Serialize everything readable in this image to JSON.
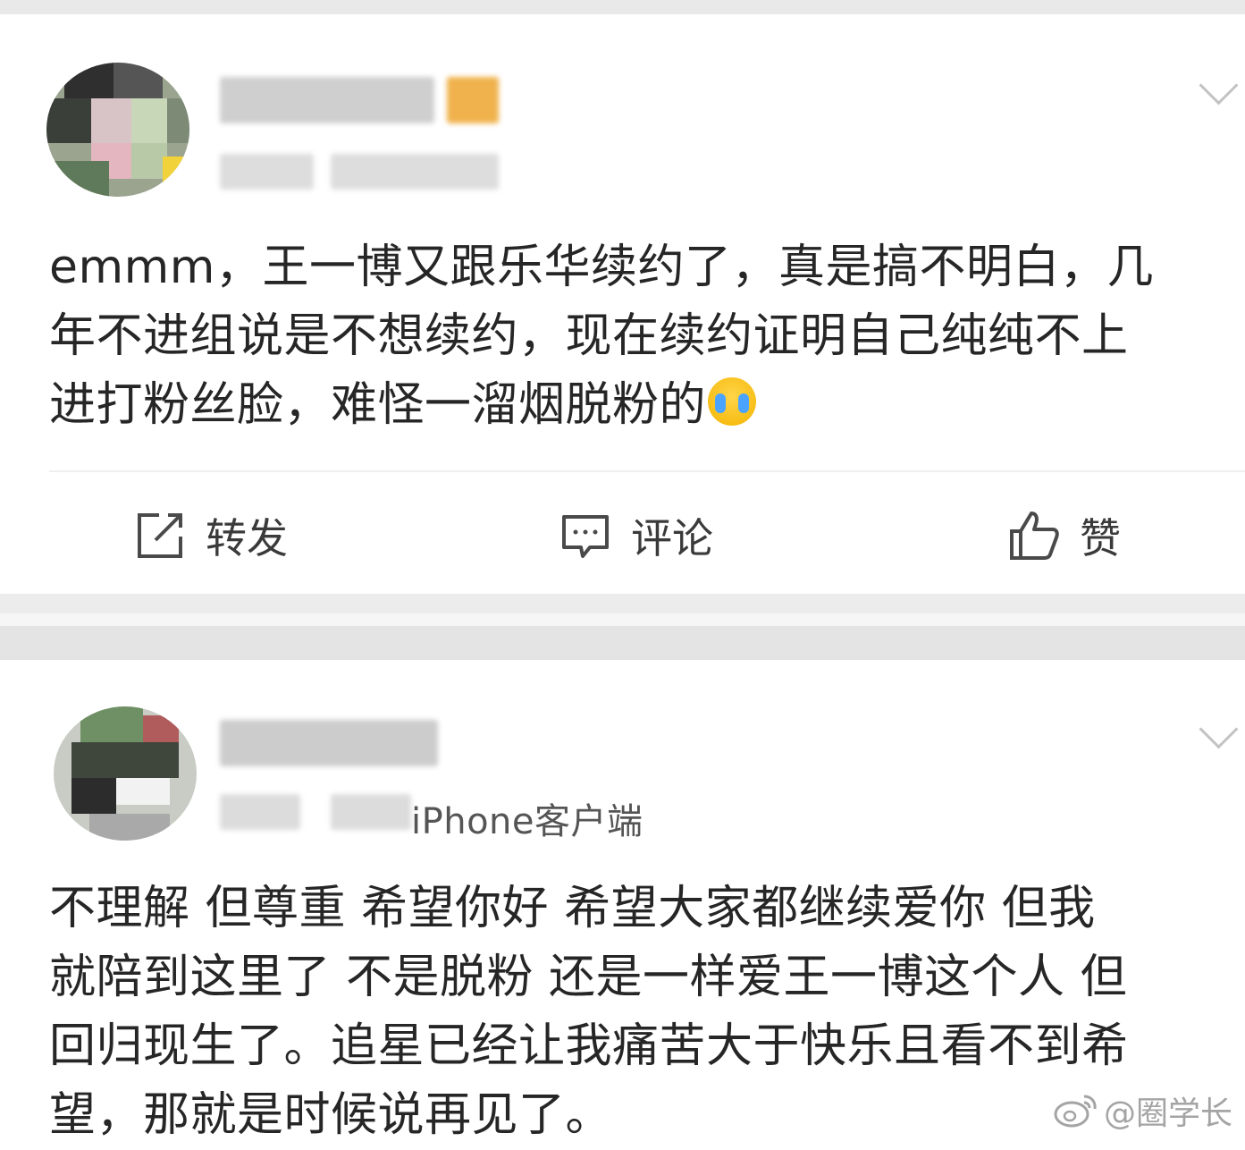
{
  "post1": {
    "lines": [
      "emmm，王一博又跟乐华续约了，真是搞不明白，几",
      "年不进组说是不想续约，现在续约证明自己纯纯不上",
      "进打粉丝脸，难怪一溜烟脱粉的"
    ],
    "emoji": "crying-face",
    "actions": {
      "repost_label": "转发",
      "comment_label": "评论",
      "like_label": "赞"
    }
  },
  "post2": {
    "client": "iPhone客户端",
    "lines": [
      "不理解 但尊重 希望你好 希望大家都继续爱你 但我",
      "就陪到这里了 不是脱粉 还是一样爱王一博这个人 但",
      "回归现生了。追星已经让我痛苦大于快乐且看不到希",
      "望，那就是时候说再见了。"
    ]
  },
  "watermark": {
    "text": "@圈学长",
    "icon": "weibo-logo-icon"
  },
  "colors": {
    "text": "#262626",
    "icon": "#4a4a4a",
    "separator": "#ececec"
  }
}
